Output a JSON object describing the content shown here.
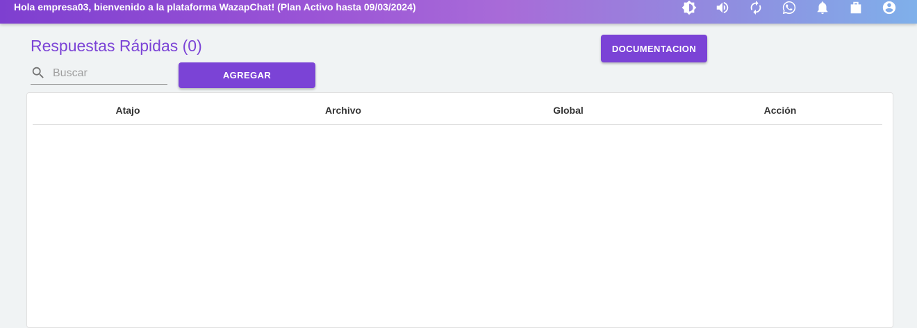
{
  "topbar": {
    "greeting": "Hola empresa03, bienvenido a la plataforma WazapChat! (Plan Activo hasta 09/03/2024)",
    "icons": [
      "theme-toggle-icon",
      "volume-icon",
      "refresh-icon",
      "whatsapp-icon",
      "bell-icon",
      "briefcase-icon",
      "account-circle-icon"
    ],
    "gradient_start": "#7e3fd0",
    "gradient_end": "#7fb0ea"
  },
  "main": {
    "title": "Respuestas Rápidas (0)",
    "doc_button": "DOCUMENTACION",
    "search_placeholder": "Buscar",
    "search_value": "",
    "add_button": "AGREGAR",
    "accent_color": "#7b43d6"
  },
  "table": {
    "columns": [
      "Atajo",
      "Archivo",
      "Global",
      "Acción"
    ],
    "rows": []
  }
}
